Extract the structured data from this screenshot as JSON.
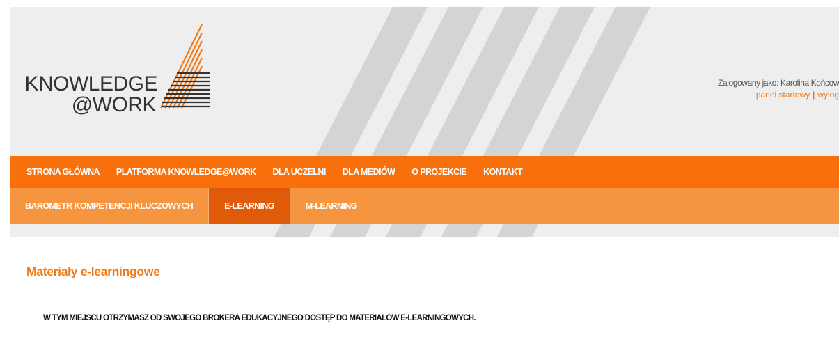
{
  "logo": {
    "line1": "KNOWLEDGE",
    "line2": "@WORK"
  },
  "user": {
    "logged_in_text": "Zalogowany jako: Karolina Końcow",
    "dashboard_link": "panel startowy",
    "separator": "|",
    "logout_link": "wylog"
  },
  "nav": {
    "main": [
      {
        "label": "STRONA GŁÓWNA"
      },
      {
        "label": "PLATFORMA KNOWLEDGE@WORK"
      },
      {
        "label": "DLA UCZELNI"
      },
      {
        "label": "DLA MEDIÓW"
      },
      {
        "label": "O PROJEKCIE"
      },
      {
        "label": "KONTAKT"
      }
    ],
    "sub": [
      {
        "label": "BAROMETR KOMPETENCJI KLUCZOWYCH",
        "active": false
      },
      {
        "label": "E-LEARNING",
        "active": true
      },
      {
        "label": "M-LEARNING",
        "active": false
      }
    ]
  },
  "content": {
    "title": "Materiały e-learningowe",
    "notice": "W TYM MIEJSCU OTRZYMASZ OD SWOJEGO BROKERA EDUKACYJNEGO DOSTĘP DO MATERIAŁÓW E-LEARNINGOWYCH."
  },
  "colors": {
    "nav_main": "#f8700c",
    "nav_sub": "#f6953f",
    "nav_sub_active": "#df5a09",
    "accent_text": "#f07a16",
    "header_bg": "#eeeeee"
  }
}
